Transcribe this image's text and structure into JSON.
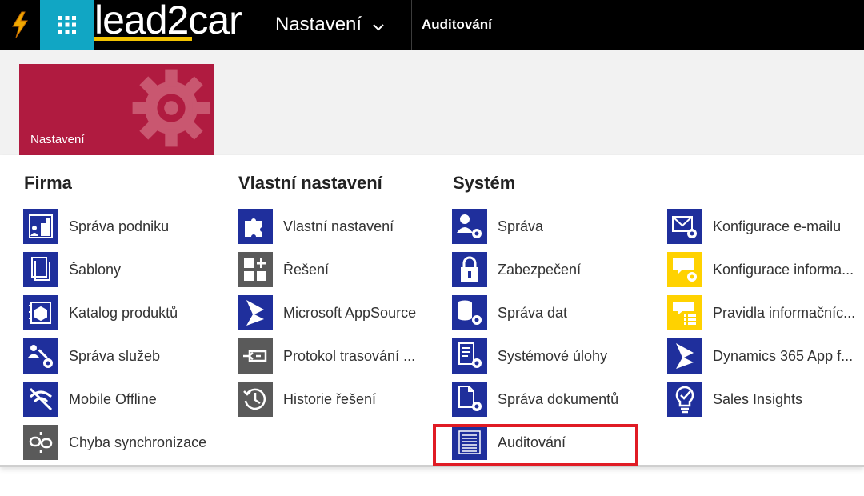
{
  "topbar": {
    "logo_text": "lead2car",
    "nav_label": "Nastavení",
    "breadcrumb": "Auditování",
    "accent_color": "#11a6c4",
    "bolt_color": "#f0a800"
  },
  "tile": {
    "label": "Nastavení",
    "color": "#b01b40"
  },
  "columns": {
    "firma": {
      "heading": "Firma",
      "items": [
        {
          "label": "Správa podniku",
          "icon": "business-management-icon"
        },
        {
          "label": "Šablony",
          "icon": "templates-icon"
        },
        {
          "label": "Katalog produktů",
          "icon": "product-catalog-icon"
        },
        {
          "label": "Správa služeb",
          "icon": "service-management-icon"
        },
        {
          "label": "Mobile Offline",
          "icon": "mobile-offline-icon"
        },
        {
          "label": "Chyba synchronizace",
          "icon": "sync-error-icon"
        }
      ]
    },
    "vlastni": {
      "heading": "Vlastní nastavení",
      "items": [
        {
          "label": "Vlastní nastavení",
          "icon": "customizations-icon"
        },
        {
          "label": "Řešení",
          "icon": "solutions-icon"
        },
        {
          "label": "Microsoft AppSource",
          "icon": "appsource-icon"
        },
        {
          "label": "Protokol trasování ...",
          "icon": "trace-log-icon"
        },
        {
          "label": "Historie řešení",
          "icon": "solution-history-icon"
        }
      ]
    },
    "system": {
      "heading": "Systém",
      "items": [
        {
          "label": "Správa",
          "icon": "administration-icon"
        },
        {
          "label": "Zabezpečení",
          "icon": "security-icon"
        },
        {
          "label": "Správa dat",
          "icon": "data-management-icon"
        },
        {
          "label": "Systémové úlohy",
          "icon": "system-jobs-icon"
        },
        {
          "label": "Správa dokumentů",
          "icon": "document-management-icon"
        },
        {
          "label": "Auditování",
          "icon": "auditing-icon"
        }
      ]
    },
    "system2": {
      "items": [
        {
          "label": "Konfigurace e-mailu",
          "icon": "email-config-icon"
        },
        {
          "label": "Konfigurace informa...",
          "icon": "info-config-icon"
        },
        {
          "label": "Pravidla informačníc...",
          "icon": "info-rules-icon"
        },
        {
          "label": "Dynamics 365 App f...",
          "icon": "dynamics-app-icon"
        },
        {
          "label": "Sales Insights",
          "icon": "sales-insights-icon"
        }
      ]
    }
  }
}
